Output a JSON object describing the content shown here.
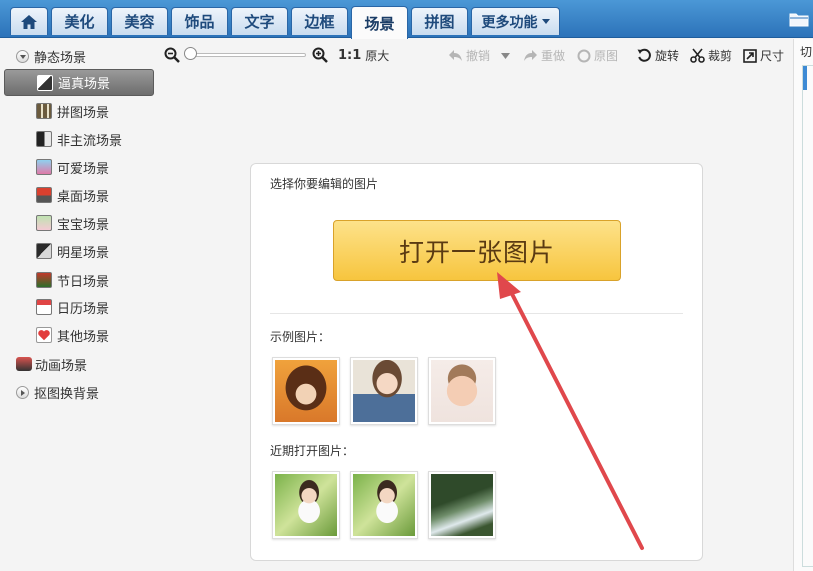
{
  "tabs": {
    "home": "home",
    "beautify": "美化",
    "beauty": "美容",
    "accessories": "饰品",
    "text": "文字",
    "frame": "边框",
    "scene": "场景",
    "collage": "拼图",
    "more": "更多功能"
  },
  "sidebar": {
    "static_group": "静态场景",
    "items": [
      {
        "label": "逼真场景",
        "icon": "realistic-scene-icon"
      },
      {
        "label": "拼图场景",
        "icon": "collage-scene-icon"
      },
      {
        "label": "非主流场景",
        "icon": "nonmainstream-scene-icon"
      },
      {
        "label": "可爱场景",
        "icon": "cute-scene-icon"
      },
      {
        "label": "桌面场景",
        "icon": "desktop-scene-icon"
      },
      {
        "label": "宝宝场景",
        "icon": "baby-scene-icon"
      },
      {
        "label": "明星场景",
        "icon": "star-scene-icon"
      },
      {
        "label": "节日场景",
        "icon": "holiday-scene-icon"
      },
      {
        "label": "日历场景",
        "icon": "calendar-scene-icon"
      },
      {
        "label": "其他场景",
        "icon": "heart-icon"
      }
    ],
    "animated_group": "动画场景",
    "cutout_group": "抠图换背景"
  },
  "toolbar": {
    "zoom_ratio": "1:1",
    "original_size": "原大",
    "undo": "撤销",
    "redo": "重做",
    "original_image": "原图",
    "rotate": "旋转",
    "crop": "裁剪",
    "size": "尺寸"
  },
  "panel": {
    "title": "选择你要编辑的图片",
    "open_button": "打开一张图片",
    "examples_label": "示例图片：",
    "recent_label": "近期打开图片："
  },
  "right_strip": {
    "label": "切"
  },
  "colors": {
    "tabbar": "#2c73b9",
    "button": "#f7c53e",
    "arrow": "#e0484c"
  }
}
